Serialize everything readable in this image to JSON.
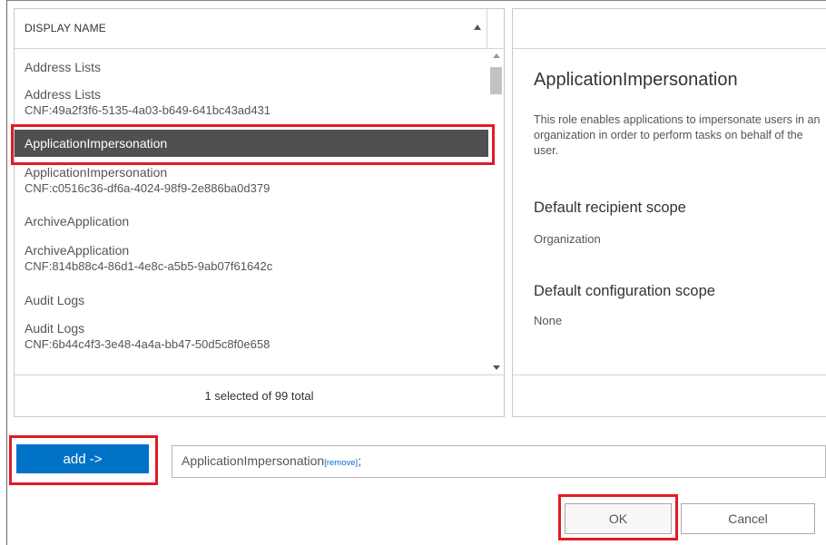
{
  "list": {
    "header_label": "DISPLAY NAME",
    "items": [
      {
        "label": "Address Lists",
        "sub": ""
      },
      {
        "label": "Address Lists",
        "sub": "CNF:49a2f3f6-5135-4a03-b649-641bc43ad431"
      },
      {
        "label": "ApplicationImpersonation",
        "sub": "",
        "selected": true
      },
      {
        "label": "ApplicationImpersonation",
        "sub": "CNF:c0516c36-df6a-4024-98f9-2e886ba0d379"
      },
      {
        "label": "ArchiveApplication",
        "sub": ""
      },
      {
        "label": "ArchiveApplication",
        "sub": "CNF:814b88c4-86d1-4e8c-a5b5-9ab07f61642c"
      },
      {
        "label": "Audit Logs",
        "sub": ""
      },
      {
        "label": "Audit Logs",
        "sub": "CNF:6b44c4f3-3e48-4a4a-bb47-50d5c8f0e658"
      }
    ],
    "footer_count": "1 selected of 99 total"
  },
  "detail": {
    "title": "ApplicationImpersonation",
    "description": "This role enables applications to impersonate users in an organization in order to perform tasks on behalf of the user.",
    "recipient_scope_heading": "Default recipient scope",
    "recipient_scope_value": "Organization",
    "config_scope_heading": "Default configuration scope",
    "config_scope_value": "None"
  },
  "add": {
    "button_label": "add ->",
    "selected_value": "ApplicationImpersonation",
    "remove_label": "[remove]",
    "separator": ";"
  },
  "dialog": {
    "ok_label": "OK",
    "cancel_label": "Cancel"
  },
  "colors": {
    "accent": "#0072c6",
    "selection": "#505050",
    "highlight": "#e31b23"
  },
  "icons": {
    "sort": "sort-ascending-icon",
    "scroll_up": "scroll-up-arrow-icon",
    "scroll_down": "scroll-down-arrow-icon"
  }
}
